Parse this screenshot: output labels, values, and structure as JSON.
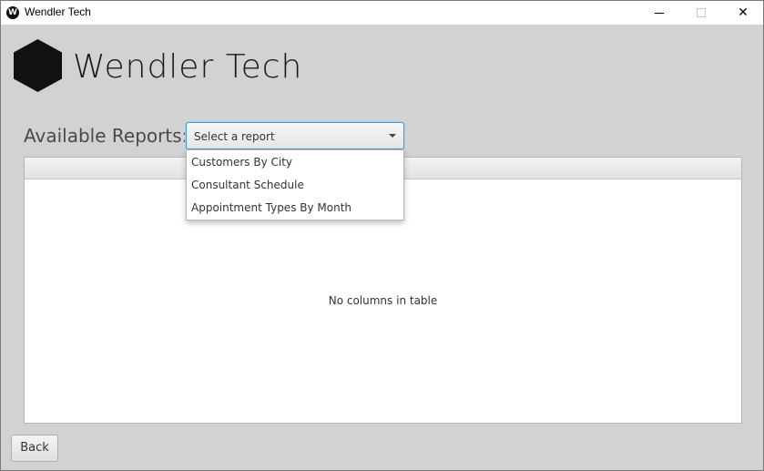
{
  "window": {
    "title": "Wendler Tech",
    "icon_letter": "W",
    "controls": {
      "minimize": "minimize",
      "maximize": "maximize",
      "close": "✕"
    }
  },
  "brand": {
    "name": "Wendler Tech",
    "logo": "hexagon-logo"
  },
  "reports": {
    "label": "Available Reports:",
    "select": {
      "placeholder": "Select a report",
      "value": "Select a report"
    },
    "options": [
      "Customers By City",
      "Consultant Schedule",
      "Appointment Types By Month"
    ]
  },
  "table": {
    "placeholder": "No columns in table"
  },
  "footer": {
    "back_label": "Back"
  },
  "colors": {
    "focus": "#3b9ad6",
    "background": "#d2d2d2"
  }
}
